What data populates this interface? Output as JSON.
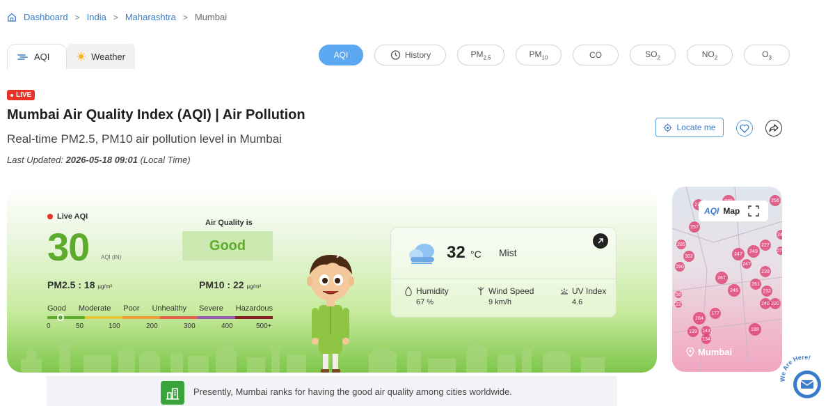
{
  "breadcrumb": {
    "items": [
      "Dashboard",
      "India",
      "Maharashtra"
    ],
    "current": "Mumbai"
  },
  "view_tabs": [
    {
      "label": "AQI",
      "active": true
    },
    {
      "label": "Weather",
      "active": false
    }
  ],
  "pills": [
    {
      "label": "AQI",
      "active": true
    },
    {
      "label": "History",
      "active": false
    },
    {
      "label": "PM2.5",
      "active": false
    },
    {
      "label": "PM10",
      "active": false
    },
    {
      "label": "CO",
      "active": false
    },
    {
      "label": "SO2",
      "active": false
    },
    {
      "label": "NO2",
      "active": false
    },
    {
      "label": "O3",
      "active": false
    }
  ],
  "header": {
    "live": "LIVE",
    "title": "Mumbai Air Quality Index (AQI) | Air Pollution",
    "subtitle": "Real-time PM2.5, PM10 air pollution level in Mumbai",
    "updated_prefix": "Last Updated:",
    "updated_time": "2026-05-18 09:01",
    "updated_suffix": "(Local Time)",
    "locate_label": "Locate me"
  },
  "aqi": {
    "live_label": "Live AQI",
    "value": "30",
    "unit": "AQI (IN)",
    "quality_label": "Air Quality is",
    "quality": "Good",
    "pm25_label": "PM2.5 :",
    "pm25_value": "18",
    "pm25_unit": "µg/m³",
    "pm10_label": "PM10 :",
    "pm10_value": "22",
    "pm10_unit": "µg/m³",
    "scale_labels": [
      "Good",
      "Moderate",
      "Poor",
      "Unhealthy",
      "Severe",
      "Hazardous"
    ],
    "scale_values": [
      "0",
      "50",
      "100",
      "200",
      "300",
      "400",
      "500+"
    ],
    "scale_colors": [
      "#5dab2c",
      "#e8c83a",
      "#f29b34",
      "#e5604a",
      "#9a5bb8",
      "#8b1d2b"
    ],
    "current_fraction": 0.06
  },
  "weather": {
    "temp": "32",
    "temp_unit": "°C",
    "condition": "Mist",
    "stats": [
      {
        "label": "Humidity",
        "value": "67 %",
        "icon": "humidity-icon"
      },
      {
        "label": "Wind Speed",
        "value": "9 km/h",
        "icon": "wind-icon"
      },
      {
        "label": "UV Index",
        "value": "4.6",
        "icon": "uv-icon"
      }
    ]
  },
  "map": {
    "brand": "AQI",
    "label": "Map",
    "location": "Mumbai",
    "markers": [
      "270",
      "279",
      "256",
      "257",
      "243",
      "227",
      "285",
      "302",
      "247",
      "249",
      "272",
      "290",
      "267",
      "247",
      "239",
      "245",
      "261",
      "232",
      "240",
      "220",
      "164",
      "177",
      "139",
      "143",
      "134",
      "188",
      "58",
      "22"
    ]
  },
  "rank": {
    "text": "Presently, Mumbai ranks for having the good air quality among cities worldwide."
  },
  "help": {
    "text": "We Are Here!"
  }
}
